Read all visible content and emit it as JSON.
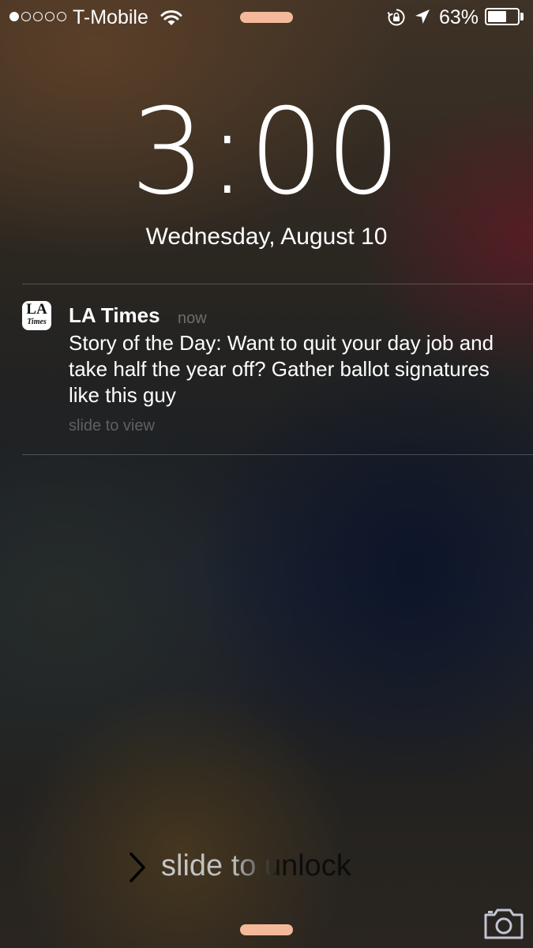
{
  "status_bar": {
    "signal_bars_filled": 1,
    "signal_bars_total": 5,
    "carrier": "T-Mobile",
    "wifi_icon": "wifi-icon",
    "rotation_lock_icon": "rotation-lock-icon",
    "location_icon": "location-arrow-icon",
    "battery_percent": "63%",
    "battery_level": 0.63
  },
  "lock_screen": {
    "time": "3:00",
    "date": "Wednesday, August 10"
  },
  "notification": {
    "app_icon": "la-times-app-icon",
    "icon_text_top": "LA",
    "icon_text_bottom": "Times",
    "app_name": "LA Times",
    "time": "now",
    "body": "Story of the Day: Want to quit your day job and take half the year off? Gather ballot signatures like this guy",
    "action_hint": "slide to view"
  },
  "unlock": {
    "chevron_icon": "chevron-right-icon",
    "label": "slide to unlock"
  },
  "bottom": {
    "camera_icon": "camera-icon"
  },
  "colors": {
    "home_indicator": "#f4b99a",
    "text_primary": "#ffffff",
    "divider": "rgba(255,255,255,0.22)"
  }
}
